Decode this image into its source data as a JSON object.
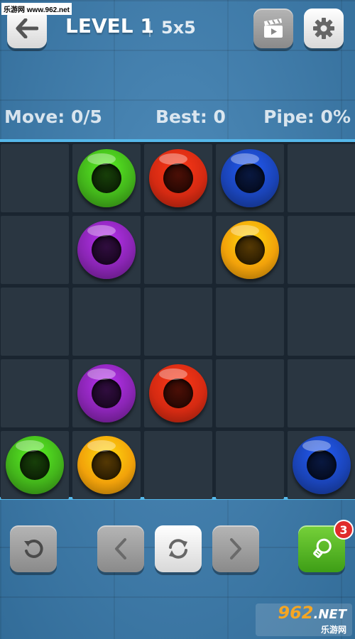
{
  "watermark_top": "乐游网 www.962.net",
  "header": {
    "level_label": "LEVEL 1",
    "grid_size": "5x5"
  },
  "stats": {
    "move": "Move: 0/5",
    "best": "Best: 0",
    "pipe": "Pipe: 0%"
  },
  "colors": {
    "green": "#43b51b",
    "red": "#d52a12",
    "blue": "#1a44b8",
    "purple": "#8a25b4",
    "yellow": "#f2a20a"
  },
  "board": {
    "rows": 5,
    "cols": 5,
    "rings": [
      {
        "row": 0,
        "col": 1,
        "color": "green"
      },
      {
        "row": 0,
        "col": 2,
        "color": "red"
      },
      {
        "row": 0,
        "col": 3,
        "color": "blue"
      },
      {
        "row": 1,
        "col": 1,
        "color": "purple"
      },
      {
        "row": 1,
        "col": 3,
        "color": "yellow"
      },
      {
        "row": 3,
        "col": 1,
        "color": "purple"
      },
      {
        "row": 3,
        "col": 2,
        "color": "red"
      },
      {
        "row": 4,
        "col": 0,
        "color": "green"
      },
      {
        "row": 4,
        "col": 1,
        "color": "yellow"
      },
      {
        "row": 4,
        "col": 4,
        "color": "blue"
      }
    ]
  },
  "toolbar": {
    "hint_count": "3",
    "icons": [
      "undo-icon",
      "chevron-left-icon",
      "refresh-icon",
      "chevron-right-icon",
      "lightbulb-icon"
    ]
  },
  "watermark_bottom": {
    "main": "962",
    "suffix": ".NET",
    "sub": "乐游网"
  }
}
